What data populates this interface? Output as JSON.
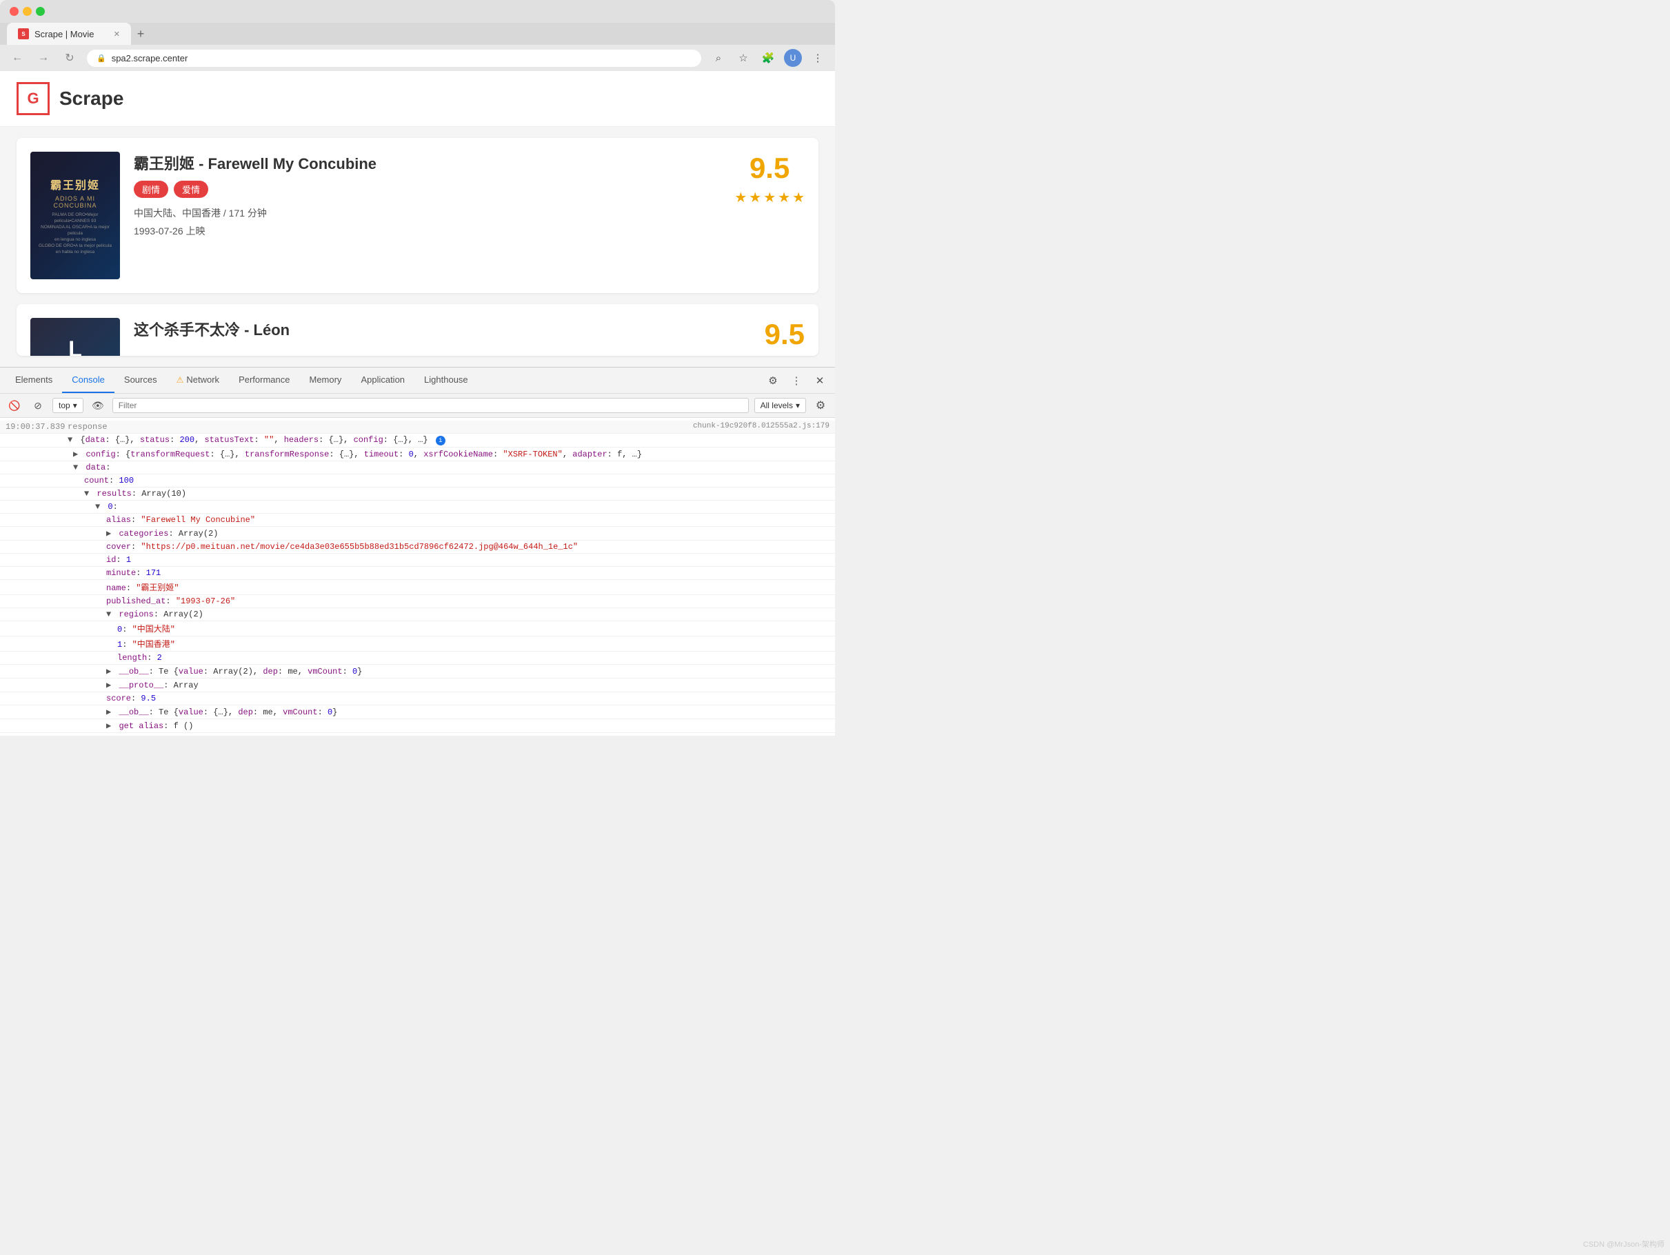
{
  "browser": {
    "tab_label": "Scrape | Movie",
    "url": "spa2.scrape.center",
    "new_tab_label": "+",
    "nav": {
      "back": "←",
      "forward": "→",
      "refresh": "↻"
    }
  },
  "site": {
    "logo_icon": "G",
    "title": "Scrape"
  },
  "movies": [
    {
      "title": "霸王别姬 - Farewell My Concubine",
      "tags": [
        "剧情",
        "爱情"
      ],
      "meta": "中国大陆、中国香港 / 171 分钟",
      "date": "1993-07-26 上映",
      "score": "9.5",
      "stars": 5,
      "poster_cn": "霸王别姬",
      "poster_subtitle": "ADIOS A MI CONCUBINA",
      "poster_award": "PALMA DE ORO•Mejor película•CANNES 93\nNOMINADA AL OSCAR•A la mejor pelicula en lengua no inglesa\nGLOBO DE ORO•A la mejor película en habla no inglesa"
    },
    {
      "title": "这个杀手不太冷 - Léon",
      "score": "9.5",
      "poster_initial": "L"
    }
  ],
  "devtools": {
    "tabs": [
      {
        "label": "Elements",
        "active": false
      },
      {
        "label": "Console",
        "active": true
      },
      {
        "label": "Sources",
        "active": false
      },
      {
        "label": "Network",
        "active": false,
        "warn": true
      },
      {
        "label": "Performance",
        "active": false
      },
      {
        "label": "Memory",
        "active": false
      },
      {
        "label": "Application",
        "active": false
      },
      {
        "label": "Lighthouse",
        "active": false
      }
    ],
    "toolbar": {
      "context": "top",
      "filter_placeholder": "Filter",
      "levels": "All levels"
    },
    "console": {
      "timestamp": "19:00:37.839",
      "source": "response",
      "chunk_link": "chunk-19c920f8.012555a2.js:179",
      "line1": "{data: {…}, status: 200, statusText: \"\", headers: {…}, config: {…}, …}",
      "status_200": "200",
      "line2": "▶ config: {transformRequest: {…}, transformResponse: {…}, timeout: 0, xsrfCookieName: \"XSRF-TOKEN\", adapter: f, …}",
      "line3": "▼ data:",
      "count": "count: 100",
      "line4": "▼ results: Array(10)",
      "line5": "▼ 0:",
      "alias": "alias: \"Farewell My Concubine\"",
      "categories": "▶ categories: Array(2)",
      "cover": "cover: \"https://p0.meituan.net/movie/ce4da3e03e655b5b88ed31b5cd7896cf62472.jpg@464w_644h_1e_1c\"",
      "id": "id: 1",
      "minute": "minute: 171",
      "name": "name: \"霸王别姬\"",
      "published_at": "published_at: \"1993-07-26\"",
      "regions": "▼ regions: Array(2)",
      "region0": "0: \"中国大陆\"",
      "region1": "1: \"中国香港\"",
      "length": "length: 2",
      "ob1": "▶ __ob__: Te {value: Array(2), dep: me, vmCount: 0}",
      "proto1": "▶ __proto__: Array",
      "score": "score: 9.5",
      "ob2": "▶ __ob__: Te {value: {…}, dep: me, vmCount: 0}",
      "get_alias": "▶ get alias: f ()"
    }
  },
  "watermark": "CSDN @MrJson-架构师"
}
